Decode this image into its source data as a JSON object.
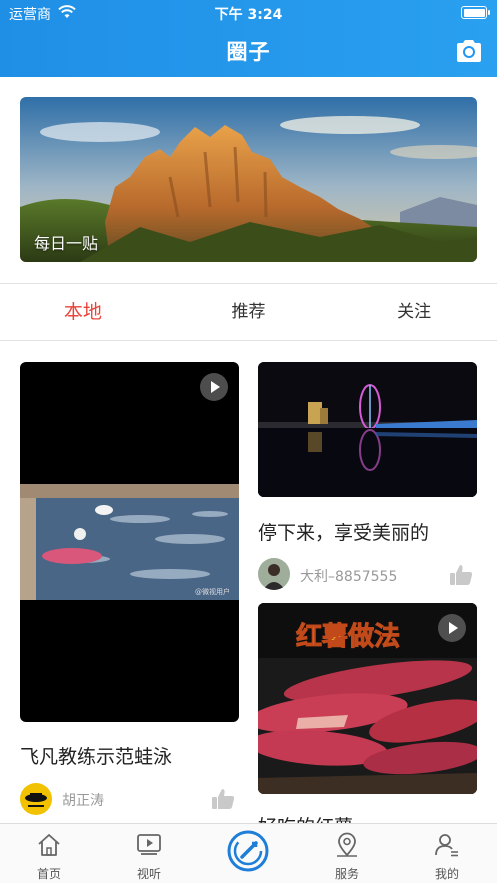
{
  "status": {
    "carrier": "运营商",
    "time": "下午 3:24"
  },
  "header": {
    "title": "圈子",
    "camera_icon": "camera-icon"
  },
  "banner": {
    "caption": "每日一贴"
  },
  "tabs": [
    {
      "label": "本地",
      "active": true
    },
    {
      "label": "推荐",
      "active": false
    },
    {
      "label": "关注",
      "active": false
    }
  ],
  "feed": {
    "left": [
      {
        "title": "飞凡教练示范蛙泳",
        "author": "胡正涛",
        "type": "video",
        "watermark": "@微视用户"
      }
    ],
    "right": [
      {
        "title": "停下来，享受美丽的",
        "author": "大利–8857555",
        "type": "image"
      },
      {
        "title": "好吃的红薯",
        "type": "video",
        "overlay_text": "红薯做法"
      }
    ]
  },
  "tabbar": {
    "items": [
      {
        "label": "首页",
        "icon": "home-icon"
      },
      {
        "label": "视听",
        "icon": "video-icon"
      },
      {
        "label": "",
        "icon": "circle-center-icon"
      },
      {
        "label": "服务",
        "icon": "location-icon"
      },
      {
        "label": "我的",
        "icon": "profile-icon"
      }
    ]
  },
  "colors": {
    "header": "#2196f3",
    "active_tab": "#e8443a",
    "accent": "#1f7fd8"
  }
}
